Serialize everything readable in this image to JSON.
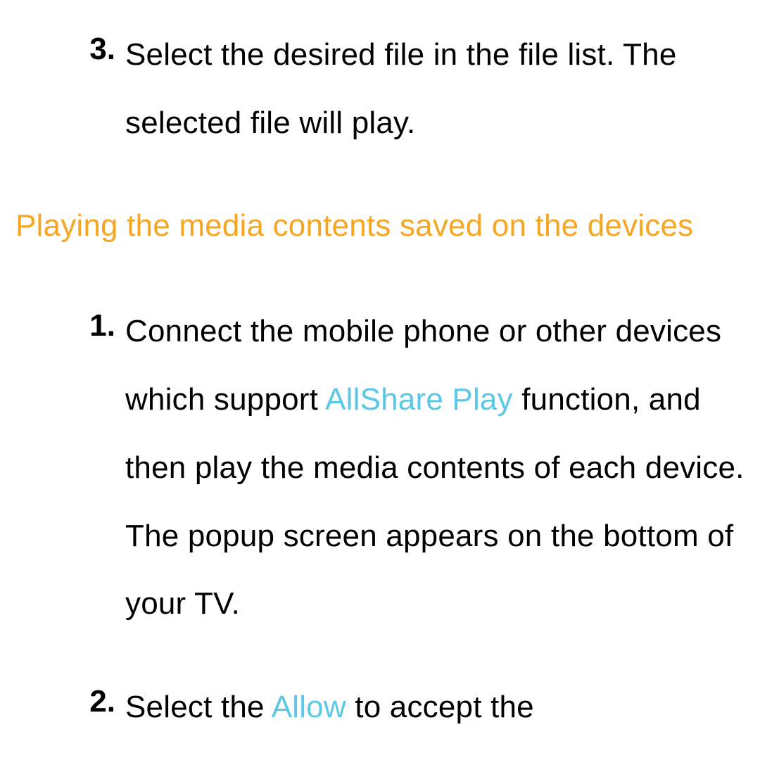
{
  "step3": {
    "num": "3.",
    "text": "Select the desired file in the file list. The selected file will play."
  },
  "heading": "Playing the media contents saved on the devices",
  "step1": {
    "num": "1.",
    "part1": "Connect the mobile phone or other devices which support ",
    "highlight": "AllShare Play",
    "part2": " function, and then play the media contents of each device. The popup screen appears on the bottom of your TV."
  },
  "step2": {
    "num": "2.",
    "part1": "Select the ",
    "highlight": "Allow",
    "part2": " to accept the"
  }
}
